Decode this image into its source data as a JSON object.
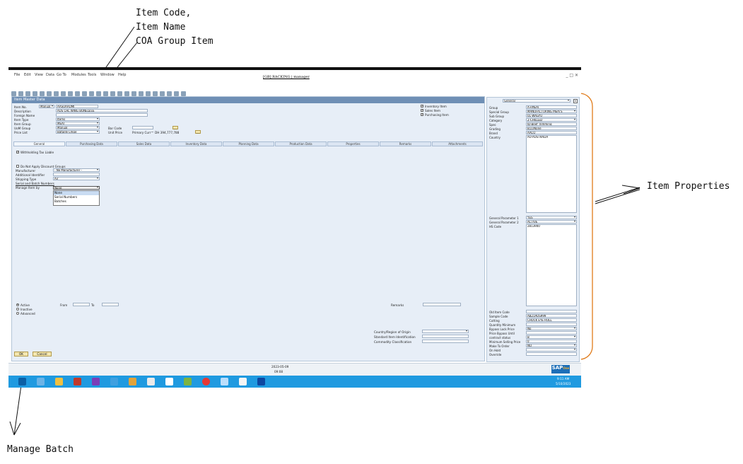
{
  "annotations": {
    "item_code": "Item Code,",
    "item_name": "Item Name",
    "coa_group": "COA Group Item",
    "item_properties": "Item Properties",
    "manage_batch": "Manage Batch"
  },
  "menu": [
    "File",
    "Edit",
    "View",
    "Data",
    "Go To",
    "Modules",
    "Tools",
    "Window",
    "Help"
  ],
  "app_title": "[GB] RACKING | manager",
  "form": {
    "title": "Item Master Data",
    "fields": {
      "item_no_label": "Item No.",
      "item_no_mode": "Manual",
      "item_no_value": "AASUAAOMI",
      "description_label": "Description",
      "description_value": "AUS CHL WING BONELESS",
      "foreign_name_label": "Foreign Name",
      "item_type_label": "Item Type",
      "item_type_value": "Items",
      "item_group_label": "Item Group",
      "item_group_value": "MEAT",
      "uom_group_label": "UoM Group",
      "uom_group_value": "Manual",
      "price_list_label": "Price List",
      "price_list_value": "Bataille Lmge",
      "bar_code_label": "Bar Code",
      "unit_price_label": "Unit Price",
      "unit_price_value": "Primary Curr™ DH 394,777,788"
    },
    "flags": {
      "inventory": "Inventory Item",
      "sales": "Sales Item",
      "purchasing": "Purchasing Item"
    },
    "tabs": [
      "General",
      "Purchasing Data",
      "Sales Data",
      "Inventory Data",
      "Planning Data",
      "Production Data",
      "Properties",
      "Remarks",
      "Attachments"
    ],
    "general": {
      "wtax": "Withholding Tax Liable",
      "no_discount": "Do Not Apply Discount Groups",
      "manufacturer_label": "Manufacturer",
      "manufacturer_value": "- No Manufacturer -",
      "additional_identifier_label": "Additional Identifier",
      "shipping_type_label": "Shipping Type",
      "shipping_type_value": "Air",
      "serial_batch_label": "Serial and Batch Numbers",
      "manage_by_label": "Manage Item by",
      "manage_by_value": "None",
      "dropdown_options": [
        "None",
        "Serial Numbers",
        "Batches"
      ],
      "active": "Active",
      "inactive": "Inactive",
      "advanced": "Advanced",
      "from": "From",
      "to": "To",
      "remarks": "Remarks",
      "country_origin": "Country/Region of Origin",
      "std_item_id": "Standard Item Identification",
      "commodity": "Commodity Classification"
    },
    "ok": "OK",
    "cancel": "Cancel"
  },
  "properties_panel": {
    "header_select": "General",
    "rows_top": [
      {
        "label": "Group",
        "value": "A+MEAT"
      },
      {
        "label": "Special Group",
        "value": "MANUFACTURING MEATS"
      },
      {
        "label": "Sub Group",
        "value": "01-WAGYU"
      },
      {
        "label": "Category",
        "value": "2-CHILLED"
      },
      {
        "label": "Spec",
        "value": "JD-Beef Trimming"
      },
      {
        "label": "Grading",
        "value": "B11|None"
      },
      {
        "label": "Brand",
        "value": "AACO"
      },
      {
        "label": "Country",
        "value": "AU-AUSTRALIA"
      }
    ],
    "rows_mid": [
      {
        "label": "General Parameter 1",
        "value": "YES"
      },
      {
        "label": "General Parameter 2",
        "value": "ACTIVE"
      },
      {
        "label": "HS Code",
        "value": "2813900"
      }
    ],
    "rows_bottom": [
      {
        "label": "Old Item Code",
        "value": ""
      },
      {
        "label": "Sample Code",
        "value": "AB21AUS999"
      },
      {
        "label": "Cutting",
        "value": "CHUCK EYE ROLL"
      },
      {
        "label": "Quantity Minimum",
        "value": ""
      },
      {
        "label": "Bypass Lock Price",
        "value": "No"
      },
      {
        "label": "Price Bypass Until",
        "value": ""
      },
      {
        "label": "contract status",
        "value": "B"
      },
      {
        "label": "Minimum Selling Price",
        "value": "0"
      },
      {
        "label": "Make To Order",
        "value": "NO"
      },
      {
        "label": "On Hold",
        "value": ""
      },
      {
        "label": "Override",
        "value": ""
      }
    ]
  },
  "status": {
    "date": "2023-05-09",
    "time": "09:08"
  },
  "brand": "SAP",
  "brand_sub": "One",
  "clock": {
    "time": "9:11 AM",
    "date": "5/10/2023"
  }
}
